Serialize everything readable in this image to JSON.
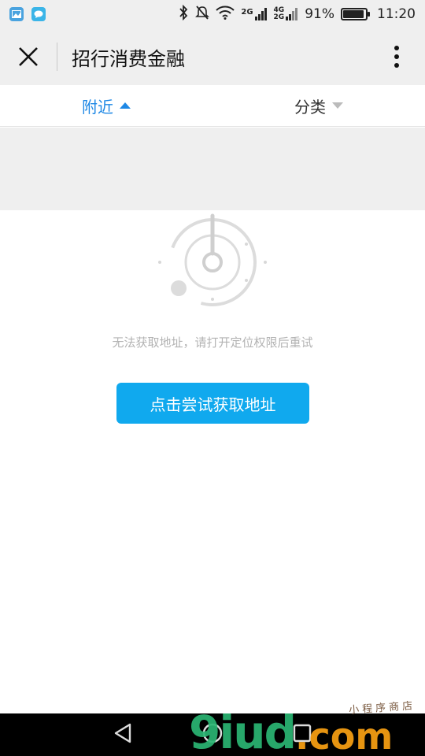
{
  "status_bar": {
    "net_top": "2G",
    "net_dual_top": "4G",
    "net_dual_bottom": "2G",
    "battery_percent": "91%",
    "battery_level": 0.91,
    "time": "11:20"
  },
  "nav": {
    "title": "招行消费金融"
  },
  "tabs": [
    {
      "label": "附近",
      "active": true
    },
    {
      "label": "分类",
      "active": false
    }
  ],
  "content": {
    "hint": "无法获取地址，请打开定位权限后重试",
    "retry_label": "点击尝试获取地址"
  },
  "watermark": {
    "main": "9iud",
    "suffix": ".com",
    "subtitle": "小程序商店"
  },
  "colors": {
    "accent": "#1e88e5",
    "button": "#10a9ee",
    "hint_text": "#b3b3b3",
    "bar_bg": "#efefef"
  }
}
